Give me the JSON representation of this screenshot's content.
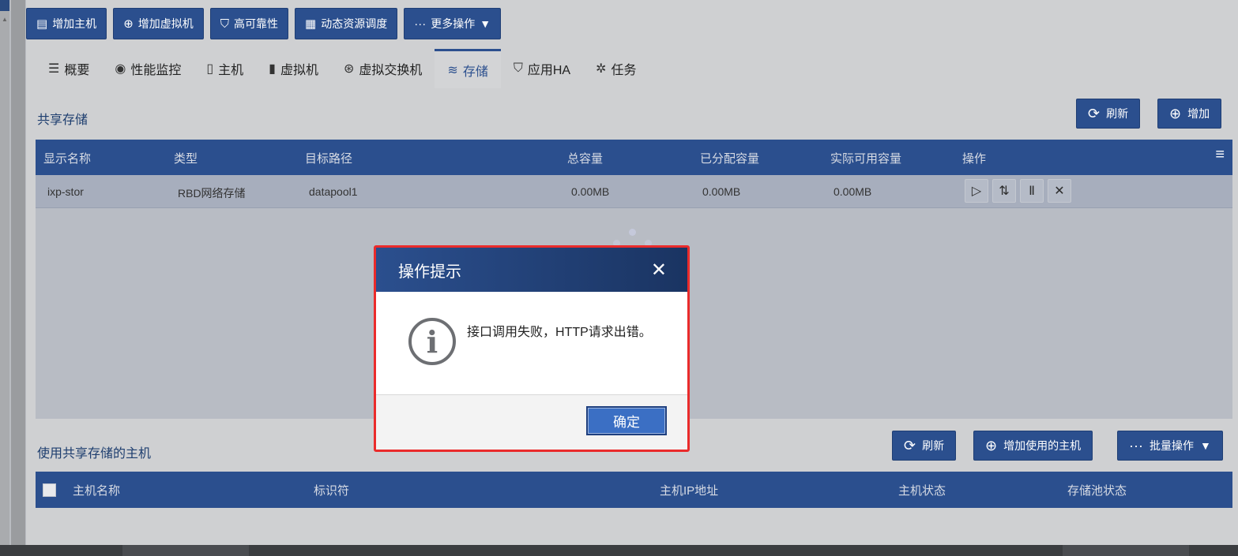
{
  "toolbar": {
    "buttons": [
      {
        "icon": "host-add-icon",
        "label": "增加主机"
      },
      {
        "icon": "plus-circle-icon",
        "label": "增加虚拟机"
      },
      {
        "icon": "shield-icon",
        "label": "高可靠性"
      },
      {
        "icon": "schedule-icon",
        "label": "动态资源调度"
      },
      {
        "icon": "more-icon",
        "label": "更多操作"
      }
    ]
  },
  "tabs": [
    {
      "icon": "list-icon",
      "label": "概要"
    },
    {
      "icon": "monitor-icon",
      "label": "性能监控"
    },
    {
      "icon": "server-icon",
      "label": "主机"
    },
    {
      "icon": "vm-icon",
      "label": "虚拟机"
    },
    {
      "icon": "switch-icon",
      "label": "虚拟交换机"
    },
    {
      "icon": "database-icon",
      "label": "存储",
      "active": true
    },
    {
      "icon": "shield-icon",
      "label": "应用HA"
    },
    {
      "icon": "task-icon",
      "label": "任务"
    }
  ],
  "shared_storage": {
    "title": "共享存储",
    "refresh_label": "刷新",
    "add_label": "增加",
    "columns": [
      "显示名称",
      "类型",
      "目标路径",
      "总容量",
      "已分配容量",
      "实际可用容量",
      "操作"
    ],
    "rows": [
      {
        "name": "ixp-stor",
        "type": "RBD网络存储",
        "path": "datapool1",
        "total": "0.00MB",
        "allocated": "0.00MB",
        "available": "0.00MB"
      }
    ]
  },
  "hosts_section": {
    "title": "使用共享存储的主机",
    "refresh_label": "刷新",
    "add_host_label": "增加使用的主机",
    "batch_label": "批量操作",
    "columns": [
      "主机名称",
      "标识符",
      "主机IP地址",
      "主机状态",
      "存储池状态"
    ]
  },
  "dialog": {
    "title": "操作提示",
    "message": "接口调用失败，HTTP请求出错。",
    "ok_label": "确定"
  },
  "colors": {
    "primary": "#2b4f8e",
    "highlight_border": "#ea2b2b",
    "ok_button": "#3b6fc4"
  }
}
